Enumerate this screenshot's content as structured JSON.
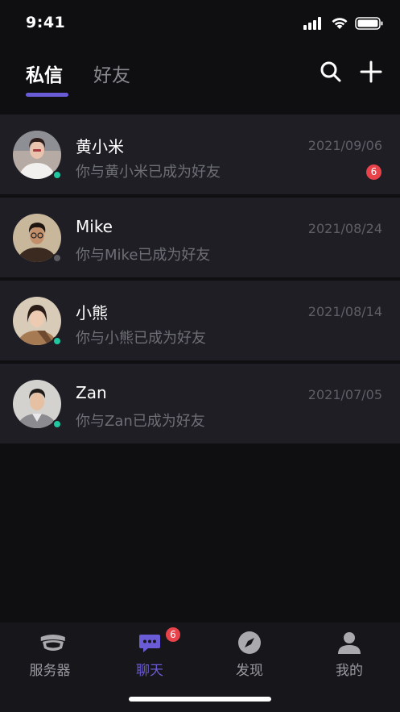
{
  "status_bar": {
    "time": "9:41",
    "icons": [
      "signal-icon",
      "wifi-icon",
      "battery-icon"
    ]
  },
  "header": {
    "tabs": [
      {
        "label": "私信",
        "active": true
      },
      {
        "label": "好友",
        "active": false
      }
    ],
    "actions": [
      "search-icon",
      "plus-icon"
    ],
    "accent_color": "#6a5bd6"
  },
  "conversations": [
    {
      "name": "黄小米",
      "preview": "你与黄小米已成为好友",
      "date": "2021/09/06",
      "unread": "6",
      "presence": "online"
    },
    {
      "name": "Mike",
      "preview": "你与Mike已成为好友",
      "date": "2021/08/24",
      "unread": "",
      "presence": "offline"
    },
    {
      "name": "小熊",
      "preview": "你与小熊已成为好友",
      "date": "2021/08/14",
      "unread": "",
      "presence": "online"
    },
    {
      "name": "Zan",
      "preview": "你与Zan已成为好友",
      "date": "2021/07/05",
      "unread": "",
      "presence": "online"
    }
  ],
  "tabbar": {
    "items": [
      {
        "label": "服务器",
        "icon": "server-icon",
        "active": false,
        "badge": ""
      },
      {
        "label": "聊天",
        "icon": "chat-icon",
        "active": true,
        "badge": "6"
      },
      {
        "label": "发现",
        "icon": "compass-icon",
        "active": false,
        "badge": ""
      },
      {
        "label": "我的",
        "icon": "profile-icon",
        "active": false,
        "badge": ""
      }
    ]
  },
  "colors": {
    "background": "#0f0f12",
    "row": "#1e1e24",
    "online": "#1ec7a0",
    "badge": "#e8434a"
  }
}
